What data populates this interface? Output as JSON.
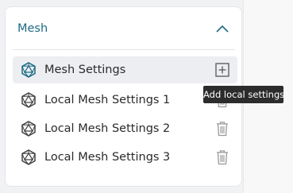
{
  "panel": {
    "title": "Mesh",
    "items": [
      {
        "label": "Mesh Settings",
        "action": "add-icon",
        "selected": true
      },
      {
        "label": "Local Mesh Settings 1",
        "action": "trash-icon"
      },
      {
        "label": "Local Mesh Settings 2",
        "action": "trash-icon"
      },
      {
        "label": "Local Mesh Settings 3",
        "action": "trash-icon"
      }
    ]
  },
  "tooltip": {
    "text": "Add local settings"
  },
  "colors": {
    "accent": "#1d6b84",
    "selected_bg": "#eceef1",
    "tooltip_bg": "#2c2c2c"
  }
}
